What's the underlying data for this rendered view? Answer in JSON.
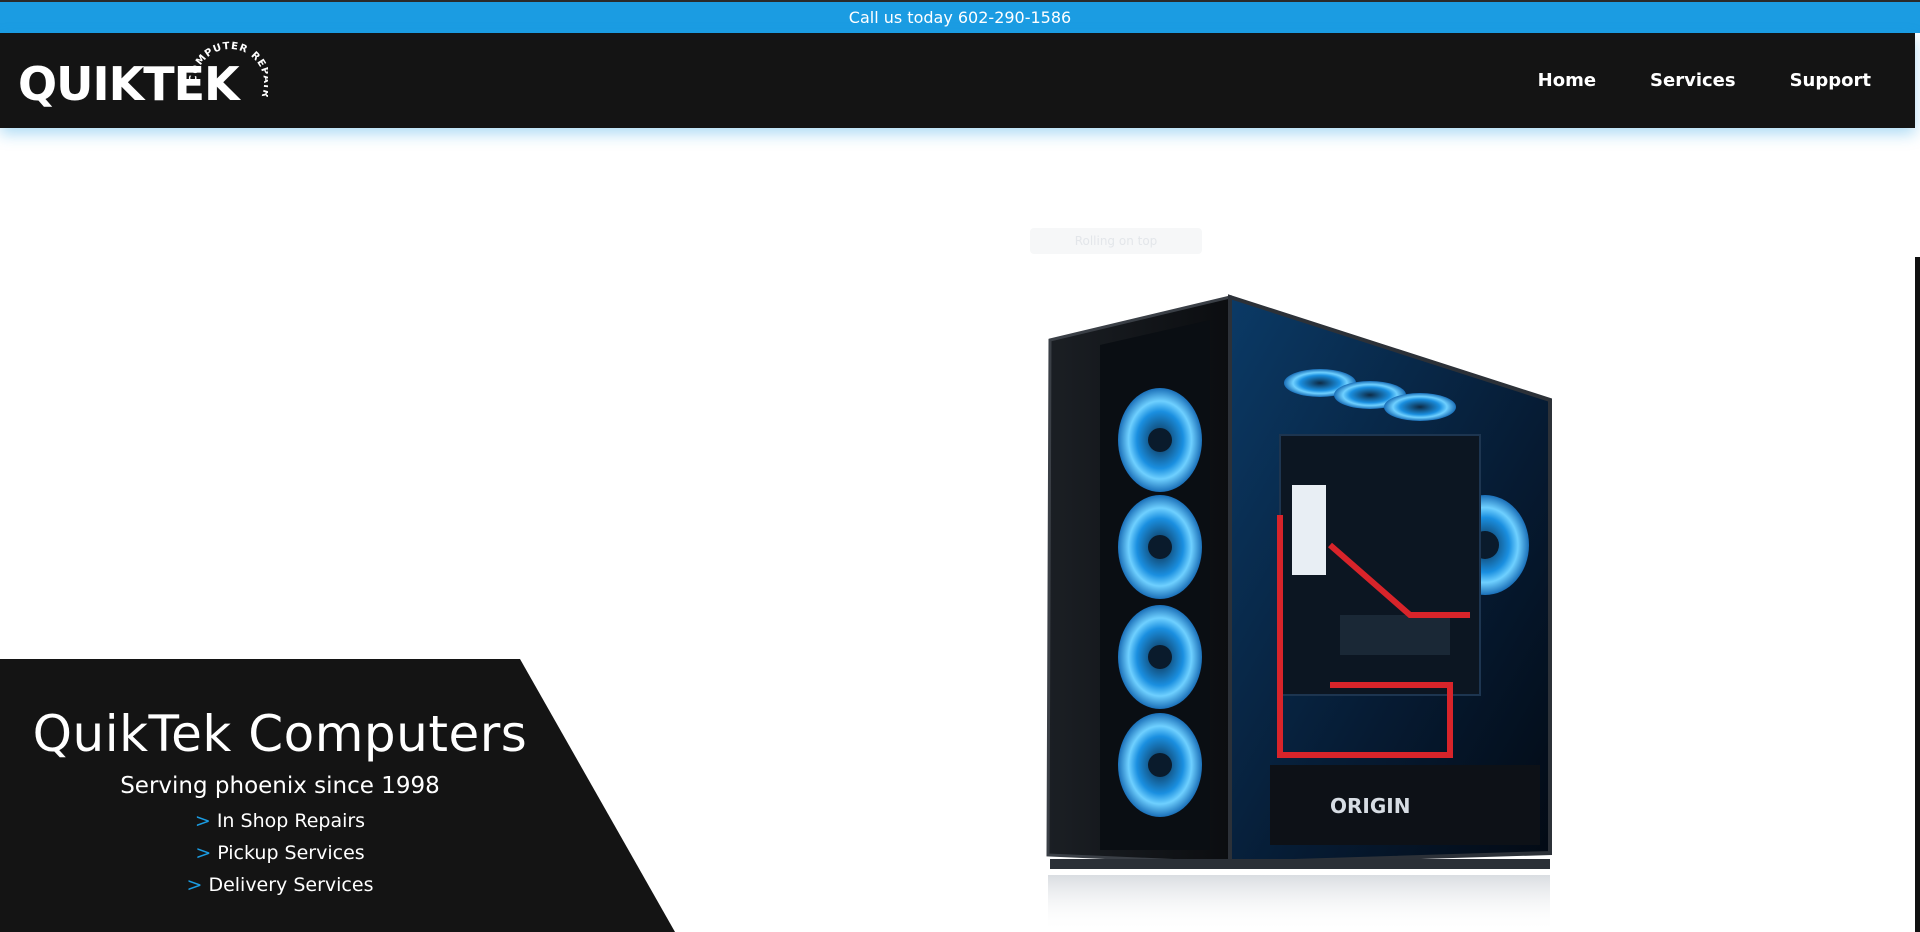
{
  "topbar": {
    "call_text": "Call us today 602-290-1586"
  },
  "logo": {
    "wordmark": "QUIKTEK",
    "arc_text": "COMPUTER REPAIR"
  },
  "nav": {
    "items": [
      {
        "label": "Home"
      },
      {
        "label": "Services"
      },
      {
        "label": "Support"
      }
    ]
  },
  "hero": {
    "hint_text": "Rolling on top",
    "image_alt_icon": "gaming-pc-tower-icon"
  },
  "promo": {
    "title": "QuikTek Computers",
    "subtitle": "Serving phoenix since 1998",
    "bullet": ">",
    "services": [
      {
        "label": "In Shop Repairs"
      },
      {
        "label": "Pickup Services"
      },
      {
        "label": "Delivery Services"
      }
    ]
  },
  "colors": {
    "accent": "#1b9ce2",
    "dark": "#141414",
    "white": "#ffffff"
  }
}
